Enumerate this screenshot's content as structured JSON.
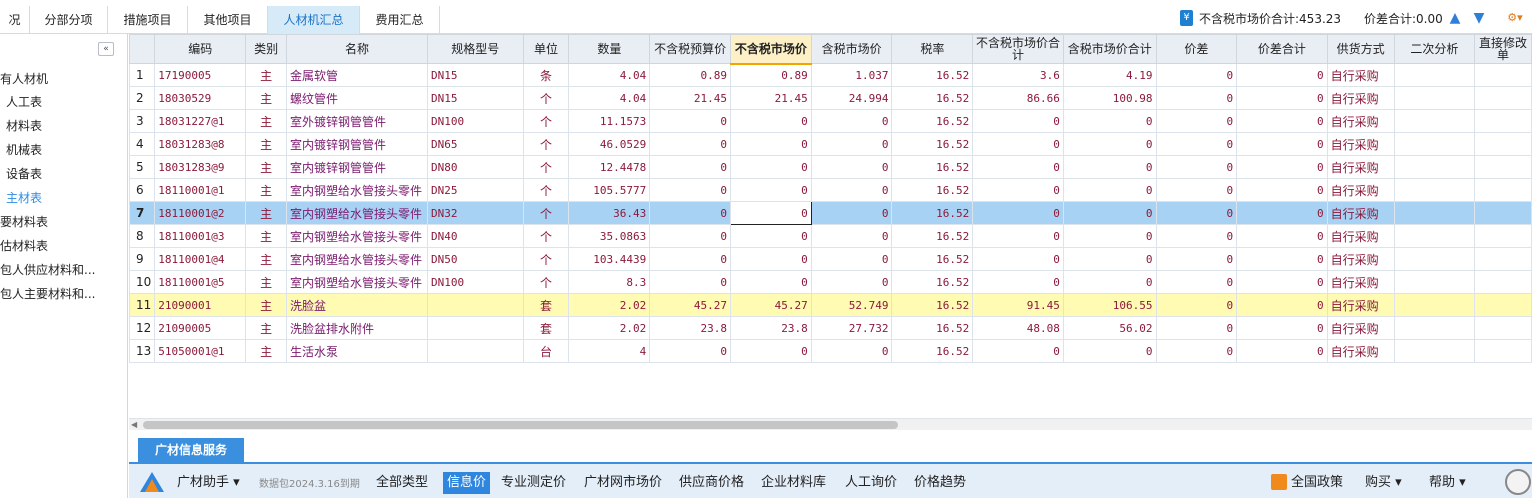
{
  "tabs": [
    {
      "label": "况"
    },
    {
      "label": "分部分项"
    },
    {
      "label": "措施项目"
    },
    {
      "label": "其他项目"
    },
    {
      "label": "人材机汇总"
    },
    {
      "label": "费用汇总"
    }
  ],
  "totals": {
    "market_total": "不含税市场价合计:453.23",
    "diff_total": "价差合计:0.00"
  },
  "sidebar": {
    "items": [
      {
        "label": "有人材机"
      },
      {
        "label": "人工表"
      },
      {
        "label": "材料表"
      },
      {
        "label": "机械表"
      },
      {
        "label": "设备表"
      },
      {
        "label": "主材表"
      },
      {
        "label": "要材料表"
      },
      {
        "label": "估材料表"
      },
      {
        "label": "包人供应材料和..."
      },
      {
        "label": "包人主要材料和..."
      }
    ]
  },
  "table": {
    "headers": [
      "",
      "编码",
      "类别",
      "名称",
      "规格型号",
      "单位",
      "数量",
      "不含税预算价",
      "不含税市场价",
      "含税市场价",
      "税率",
      "不含税市场价合计",
      "含税市场价合计",
      "价差",
      "价差合计",
      "供货方式",
      "二次分析",
      "直接修改单"
    ],
    "rows": [
      {
        "idx": "1",
        "code": "17190005",
        "cat": "主",
        "name": "金属软管",
        "spec": "DN15",
        "unit": "条",
        "qty": "4.04",
        "budget": "0.89",
        "market": "0.89",
        "tax_market": "1.037",
        "rate": "16.52",
        "market_sum": "3.6",
        "tax_market_sum": "4.19",
        "diff": "0",
        "diff_sum": "0",
        "supply": "自行采购"
      },
      {
        "idx": "2",
        "code": "18030529",
        "cat": "主",
        "name": "螺纹管件",
        "spec": "DN15",
        "unit": "个",
        "qty": "4.04",
        "budget": "21.45",
        "market": "21.45",
        "tax_market": "24.994",
        "rate": "16.52",
        "market_sum": "86.66",
        "tax_market_sum": "100.98",
        "diff": "0",
        "diff_sum": "0",
        "supply": "自行采购"
      },
      {
        "idx": "3",
        "code": "18031227@1",
        "cat": "主",
        "name": "室外镀锌钢管管件",
        "spec": "DN100",
        "unit": "个",
        "qty": "11.1573",
        "budget": "0",
        "market": "0",
        "tax_market": "0",
        "rate": "16.52",
        "market_sum": "0",
        "tax_market_sum": "0",
        "diff": "0",
        "diff_sum": "0",
        "supply": "自行采购"
      },
      {
        "idx": "4",
        "code": "18031283@8",
        "cat": "主",
        "name": "室内镀锌钢管管件",
        "spec": "DN65",
        "unit": "个",
        "qty": "46.0529",
        "budget": "0",
        "market": "0",
        "tax_market": "0",
        "rate": "16.52",
        "market_sum": "0",
        "tax_market_sum": "0",
        "diff": "0",
        "diff_sum": "0",
        "supply": "自行采购"
      },
      {
        "idx": "5",
        "code": "18031283@9",
        "cat": "主",
        "name": "室内镀锌钢管管件",
        "spec": "DN80",
        "unit": "个",
        "qty": "12.4478",
        "budget": "0",
        "market": "0",
        "tax_market": "0",
        "rate": "16.52",
        "market_sum": "0",
        "tax_market_sum": "0",
        "diff": "0",
        "diff_sum": "0",
        "supply": "自行采购"
      },
      {
        "idx": "6",
        "code": "18110001@1",
        "cat": "主",
        "name": "室内钢塑给水管接头零件",
        "spec": "DN25",
        "unit": "个",
        "qty": "105.5777",
        "budget": "0",
        "market": "0",
        "tax_market": "0",
        "rate": "16.52",
        "market_sum": "0",
        "tax_market_sum": "0",
        "diff": "0",
        "diff_sum": "0",
        "supply": "自行采购"
      },
      {
        "idx": "7",
        "code": "18110001@2",
        "cat": "主",
        "name": "室内钢塑给水管接头零件",
        "spec": "DN32",
        "unit": "个",
        "qty": "36.43",
        "budget": "0",
        "market": "0",
        "tax_market": "0",
        "rate": "16.52",
        "market_sum": "0",
        "tax_market_sum": "0",
        "diff": "0",
        "diff_sum": "0",
        "supply": "自行采购"
      },
      {
        "idx": "8",
        "code": "18110001@3",
        "cat": "主",
        "name": "室内钢塑给水管接头零件",
        "spec": "DN40",
        "unit": "个",
        "qty": "35.0863",
        "budget": "0",
        "market": "0",
        "tax_market": "0",
        "rate": "16.52",
        "market_sum": "0",
        "tax_market_sum": "0",
        "diff": "0",
        "diff_sum": "0",
        "supply": "自行采购"
      },
      {
        "idx": "9",
        "code": "18110001@4",
        "cat": "主",
        "name": "室内钢塑给水管接头零件",
        "spec": "DN50",
        "unit": "个",
        "qty": "103.4439",
        "budget": "0",
        "market": "0",
        "tax_market": "0",
        "rate": "16.52",
        "market_sum": "0",
        "tax_market_sum": "0",
        "diff": "0",
        "diff_sum": "0",
        "supply": "自行采购"
      },
      {
        "idx": "10",
        "code": "18110001@5",
        "cat": "主",
        "name": "室内钢塑给水管接头零件",
        "spec": "DN100",
        "unit": "个",
        "qty": "8.3",
        "budget": "0",
        "market": "0",
        "tax_market": "0",
        "rate": "16.52",
        "market_sum": "0",
        "tax_market_sum": "0",
        "diff": "0",
        "diff_sum": "0",
        "supply": "自行采购"
      },
      {
        "idx": "11",
        "code": "21090001",
        "cat": "主",
        "name": "洗脸盆",
        "spec": "",
        "unit": "套",
        "qty": "2.02",
        "budget": "45.27",
        "market": "45.27",
        "tax_market": "52.749",
        "rate": "16.52",
        "market_sum": "91.45",
        "tax_market_sum": "106.55",
        "diff": "0",
        "diff_sum": "0",
        "supply": "自行采购"
      },
      {
        "idx": "12",
        "code": "21090005",
        "cat": "主",
        "name": "洗脸盆排水附件",
        "spec": "",
        "unit": "套",
        "qty": "2.02",
        "budget": "23.8",
        "market": "23.8",
        "tax_market": "27.732",
        "rate": "16.52",
        "market_sum": "48.08",
        "tax_market_sum": "56.02",
        "diff": "0",
        "diff_sum": "0",
        "supply": "自行采购"
      },
      {
        "idx": "13",
        "code": "51050001@1",
        "cat": "主",
        "name": "生活水泵",
        "spec": "",
        "unit": "台",
        "qty": "4",
        "budget": "0",
        "market": "0",
        "tax_market": "0",
        "rate": "16.52",
        "market_sum": "0",
        "tax_market_sum": "0",
        "diff": "0",
        "diff_sum": "0",
        "supply": "自行采购"
      }
    ]
  },
  "bottom": {
    "tab_label": "广材信息服务",
    "helper_label": "广材助手",
    "package_note": "数据包2024.3.16到期",
    "menu": [
      {
        "label": "全部类型"
      },
      {
        "label": "信息价"
      },
      {
        "label": "专业测定价"
      },
      {
        "label": "广材网市场价"
      },
      {
        "label": "供应商价格"
      },
      {
        "label": "企业材料库"
      },
      {
        "label": "人工询价"
      },
      {
        "label": "价格趋势"
      }
    ],
    "policy_label": "全国政策",
    "buy_label": "购买",
    "help_label": "帮助"
  },
  "colors": {
    "accent": "#3a8fde",
    "selected_row": "#a8d2f4",
    "highlight_row": "#fffbb3",
    "value_text": "#8b1a3a"
  }
}
